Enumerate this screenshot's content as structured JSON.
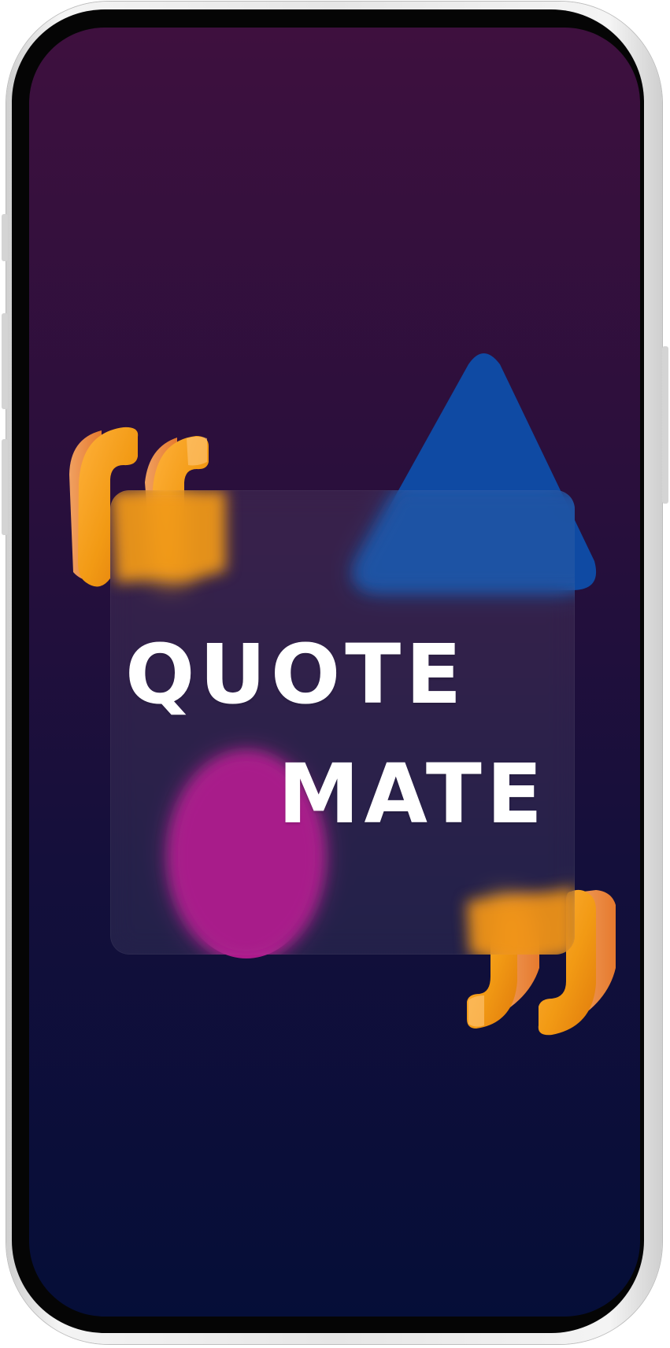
{
  "app": {
    "title_line_1": "QUOTE",
    "title_line_2": "MATE"
  },
  "colors": {
    "background_top": "#3e103e",
    "background_bottom": "#050e38",
    "triangle_blue": "#0f4aa3",
    "blob_magenta": "#ad1a8c",
    "quote_orange": "#f29a14",
    "card_glass": "rgba(255,255,255,0.08)",
    "title_text": "#ffffff"
  },
  "icons": {
    "open_quote": "opening-quotation-mark-icon",
    "close_quote": "closing-quotation-mark-icon",
    "triangle": "triangle-shape",
    "blob": "magenta-blob-shape"
  }
}
